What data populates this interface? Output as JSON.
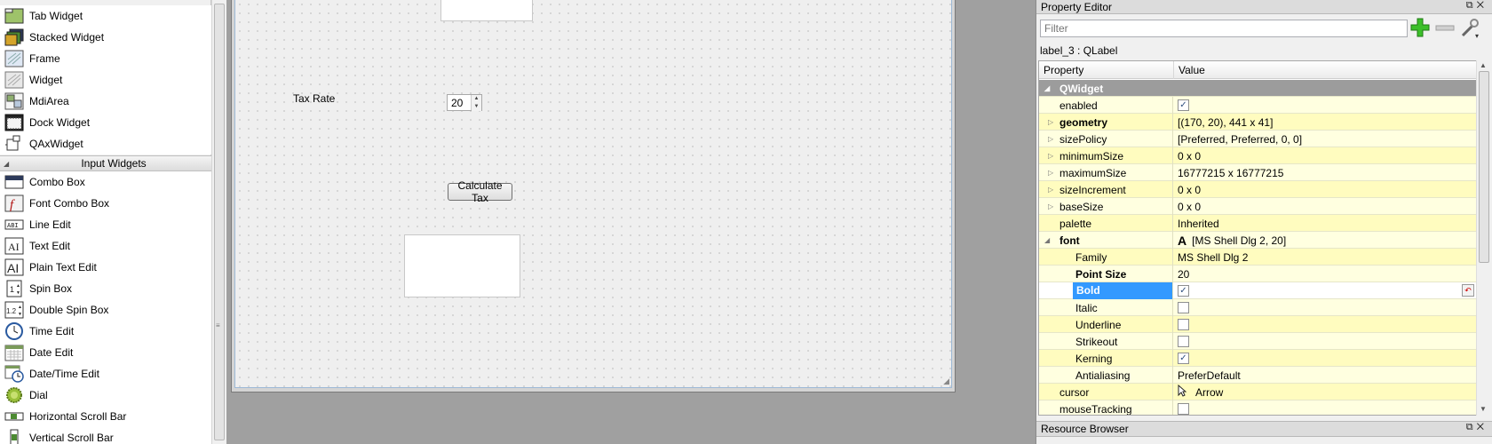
{
  "widget_box": {
    "items_top": [
      {
        "label": "Tab Widget",
        "icon": "tab-widget-icon"
      },
      {
        "label": "Stacked Widget",
        "icon": "stacked-widget-icon"
      },
      {
        "label": "Frame",
        "icon": "frame-icon"
      },
      {
        "label": "Widget",
        "icon": "widget-icon"
      },
      {
        "label": "MdiArea",
        "icon": "mdi-area-icon"
      },
      {
        "label": "Dock Widget",
        "icon": "dock-widget-icon"
      },
      {
        "label": "QAxWidget",
        "icon": "qaxwidget-icon"
      }
    ],
    "category": "Input Widgets",
    "items_input": [
      {
        "label": "Combo Box",
        "icon": "combo-box-icon"
      },
      {
        "label": "Font Combo Box",
        "icon": "font-combo-box-icon"
      },
      {
        "label": "Line Edit",
        "icon": "line-edit-icon"
      },
      {
        "label": "Text Edit",
        "icon": "text-edit-icon"
      },
      {
        "label": "Plain Text Edit",
        "icon": "plain-text-edit-icon"
      },
      {
        "label": "Spin Box",
        "icon": "spin-box-icon"
      },
      {
        "label": "Double Spin Box",
        "icon": "double-spin-box-icon"
      },
      {
        "label": "Time Edit",
        "icon": "time-edit-icon"
      },
      {
        "label": "Date Edit",
        "icon": "date-edit-icon"
      },
      {
        "label": "Date/Time Edit",
        "icon": "date-time-edit-icon"
      },
      {
        "label": "Dial",
        "icon": "dial-icon"
      },
      {
        "label": "Horizontal Scroll Bar",
        "icon": "horizontal-scroll-bar-icon"
      },
      {
        "label": "Vertical Scroll Bar",
        "icon": "vertical-scroll-bar-icon"
      }
    ]
  },
  "form": {
    "tax_rate_label": "Tax Rate",
    "tax_rate_value": "20",
    "calculate_button": "Calculate Tax"
  },
  "property_editor": {
    "title": "Property Editor",
    "filter_placeholder": "Filter",
    "object_label": "label_3 : QLabel",
    "col_property": "Property",
    "col_value": "Value",
    "group": "QWidget",
    "rows": {
      "enabled": {
        "name": "enabled",
        "checked": true
      },
      "geometry": {
        "name": "geometry",
        "value": "[(170, 20), 441 x 41]"
      },
      "sizePolicy": {
        "name": "sizePolicy",
        "value": "[Preferred, Preferred, 0, 0]"
      },
      "minimumSize": {
        "name": "minimumSize",
        "value": "0 x 0"
      },
      "maximumSize": {
        "name": "maximumSize",
        "value": "16777215 x 16777215"
      },
      "sizeIncrement": {
        "name": "sizeIncrement",
        "value": "0 x 0"
      },
      "baseSize": {
        "name": "baseSize",
        "value": "0 x 0"
      },
      "palette": {
        "name": "palette",
        "value": "Inherited"
      },
      "font": {
        "name": "font",
        "value": "[MS Shell Dlg 2, 20]",
        "glyph": "A"
      },
      "family": {
        "name": "Family",
        "value": "MS Shell Dlg 2"
      },
      "pointSize": {
        "name": "Point Size",
        "value": "20"
      },
      "bold": {
        "name": "Bold",
        "checked": true
      },
      "italic": {
        "name": "Italic",
        "checked": false
      },
      "underline": {
        "name": "Underline",
        "checked": false
      },
      "strikeout": {
        "name": "Strikeout",
        "checked": false
      },
      "kerning": {
        "name": "Kerning",
        "checked": true
      },
      "antialiasing": {
        "name": "Antialiasing",
        "value": "PreferDefault"
      },
      "cursor": {
        "name": "cursor",
        "value": "Arrow"
      },
      "mouseTracking": {
        "name": "mouseTracking",
        "checked": false
      }
    }
  },
  "resource_browser": {
    "title": "Resource Browser"
  },
  "colors": {
    "selection": "#3399ff",
    "row_yellow": "#ffffe0",
    "group_header": "#9c9c9c",
    "canvas": "#a0a0a0"
  }
}
